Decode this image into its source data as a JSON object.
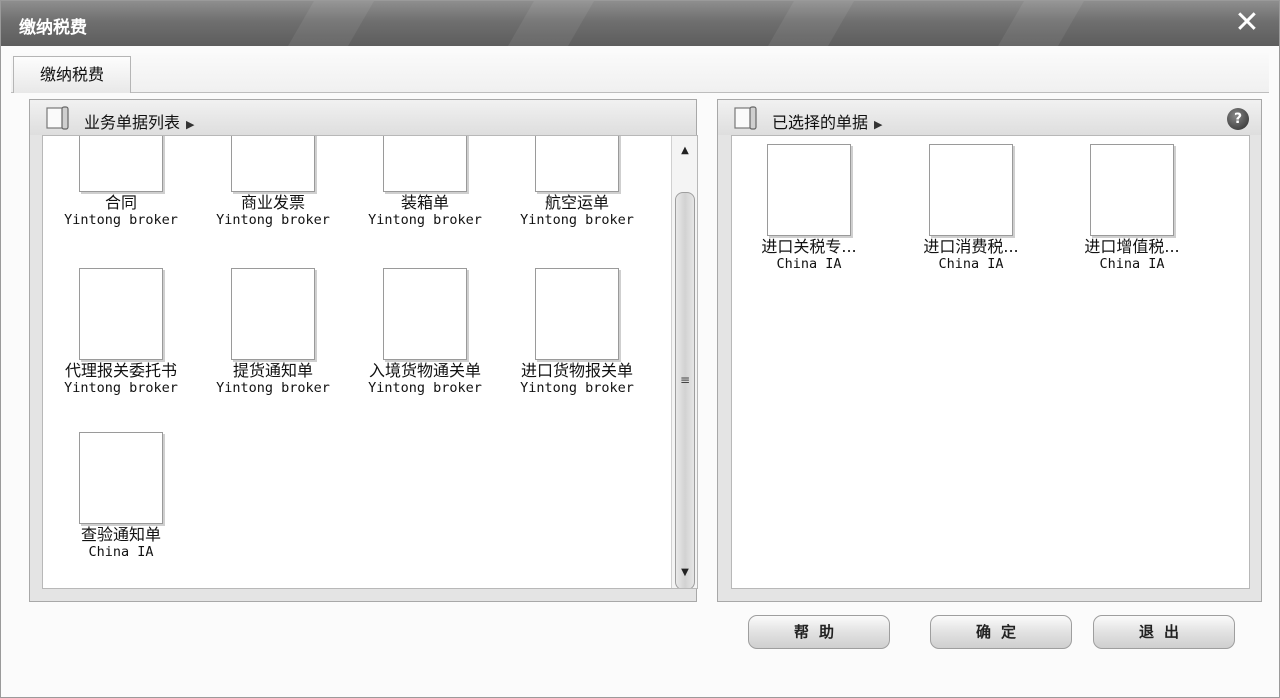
{
  "window": {
    "title": "缴纳税费"
  },
  "tab": {
    "label": "缴纳税费"
  },
  "left_panel": {
    "title": "业务单据列表",
    "documents": [
      {
        "name": "合同",
        "owner": "Yintong broker"
      },
      {
        "name": "商业发票",
        "owner": "Yintong broker"
      },
      {
        "name": "装箱单",
        "owner": "Yintong broker"
      },
      {
        "name": "航空运单",
        "owner": "Yintong broker"
      },
      {
        "name": "代理报关委托书",
        "owner": "Yintong broker"
      },
      {
        "name": "提货通知单",
        "owner": "Yintong broker"
      },
      {
        "name": "入境货物通关单",
        "owner": "Yintong broker"
      },
      {
        "name": "进口货物报关单",
        "owner": "Yintong broker"
      },
      {
        "name": "查验通知单",
        "owner": "China IA"
      }
    ]
  },
  "right_panel": {
    "title": "已选择的单据",
    "documents": [
      {
        "name": "进口关税专...",
        "owner": "China IA"
      },
      {
        "name": "进口消费税...",
        "owner": "China IA"
      },
      {
        "name": "进口增值税...",
        "owner": "China IA"
      }
    ]
  },
  "buttons": {
    "help": "帮助",
    "confirm": "确定",
    "exit": "退出"
  },
  "icons": {
    "close": "close-icon",
    "help": "help-icon",
    "book": "book-icon"
  }
}
